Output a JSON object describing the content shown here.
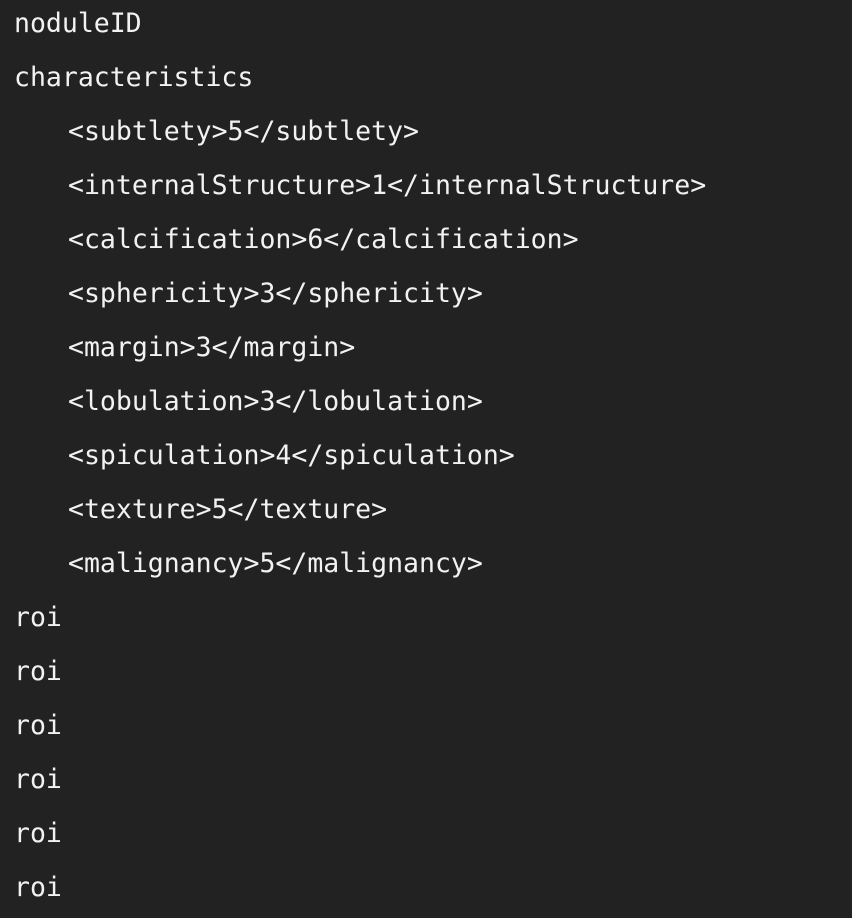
{
  "code": {
    "lines": [
      {
        "text": "noduleID",
        "indent": 0
      },
      {
        "text": "characteristics",
        "indent": 0
      },
      {
        "text": "<subtlety>5</subtlety>",
        "indent": 1
      },
      {
        "text": "<internalStructure>1</internalStructure>",
        "indent": 1
      },
      {
        "text": "<calcification>6</calcification>",
        "indent": 1
      },
      {
        "text": "<sphericity>3</sphericity>",
        "indent": 1
      },
      {
        "text": "<margin>3</margin>",
        "indent": 1
      },
      {
        "text": "<lobulation>3</lobulation>",
        "indent": 1
      },
      {
        "text": "<spiculation>4</spiculation>",
        "indent": 1
      },
      {
        "text": "<texture>5</texture>",
        "indent": 1
      },
      {
        "text": "<malignancy>5</malignancy>",
        "indent": 1
      },
      {
        "text": "roi",
        "indent": 0
      },
      {
        "text": "roi",
        "indent": 0
      },
      {
        "text": "roi",
        "indent": 0
      },
      {
        "text": "roi",
        "indent": 0
      },
      {
        "text": "roi",
        "indent": 0
      },
      {
        "text": "roi",
        "indent": 0
      }
    ]
  },
  "colors": {
    "background": "#222222",
    "text": "#f2f2f2"
  }
}
